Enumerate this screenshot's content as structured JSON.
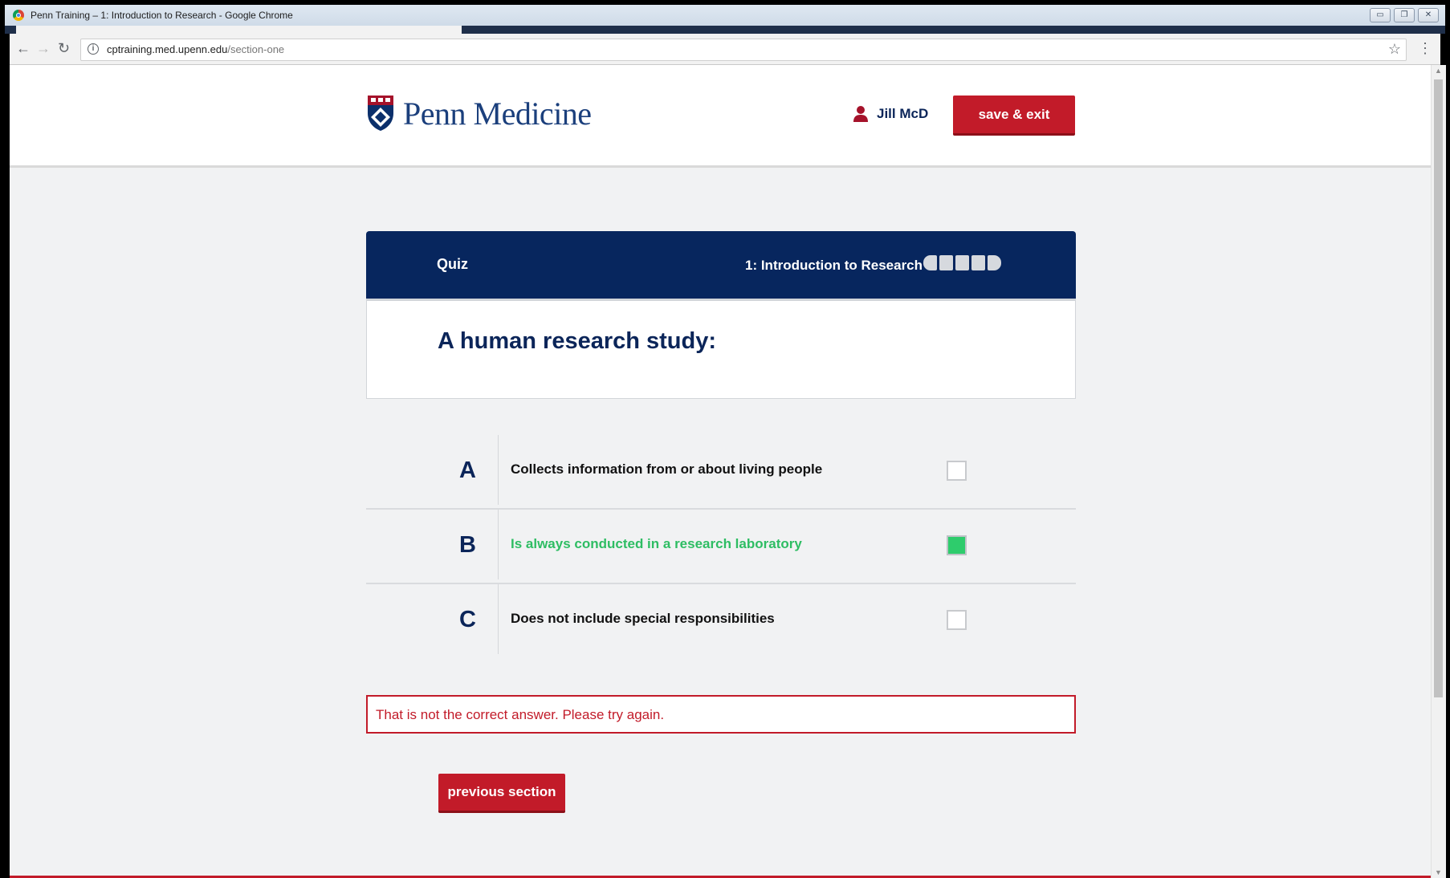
{
  "browser": {
    "window_title": "Penn Training – 1: Introduction to Research - Google Chrome",
    "url_host": "cptraining.med.upenn.edu",
    "url_path": "/section-one"
  },
  "header": {
    "logo_text": "Penn Medicine",
    "user_name": "Jill McD",
    "save_exit_label": "save & exit"
  },
  "quiz": {
    "label": "Quiz",
    "section_title": "1: Introduction to Research",
    "progress_segments": 5,
    "question": "A human research study:",
    "answers": [
      {
        "letter": "A",
        "text": "Collects information from or about living people",
        "checked": false
      },
      {
        "letter": "B",
        "text": "Is always conducted in a research laboratory",
        "checked": true
      },
      {
        "letter": "C",
        "text": "Does not include special responsibilities",
        "checked": false
      }
    ],
    "error_message": "That is not the correct answer. Please try again.",
    "previous_label": "previous section"
  },
  "colors": {
    "navy": "#07265e",
    "brand_red": "#c21b29",
    "selected_green": "#2ecc6c",
    "page_bg": "#f1f2f3"
  }
}
